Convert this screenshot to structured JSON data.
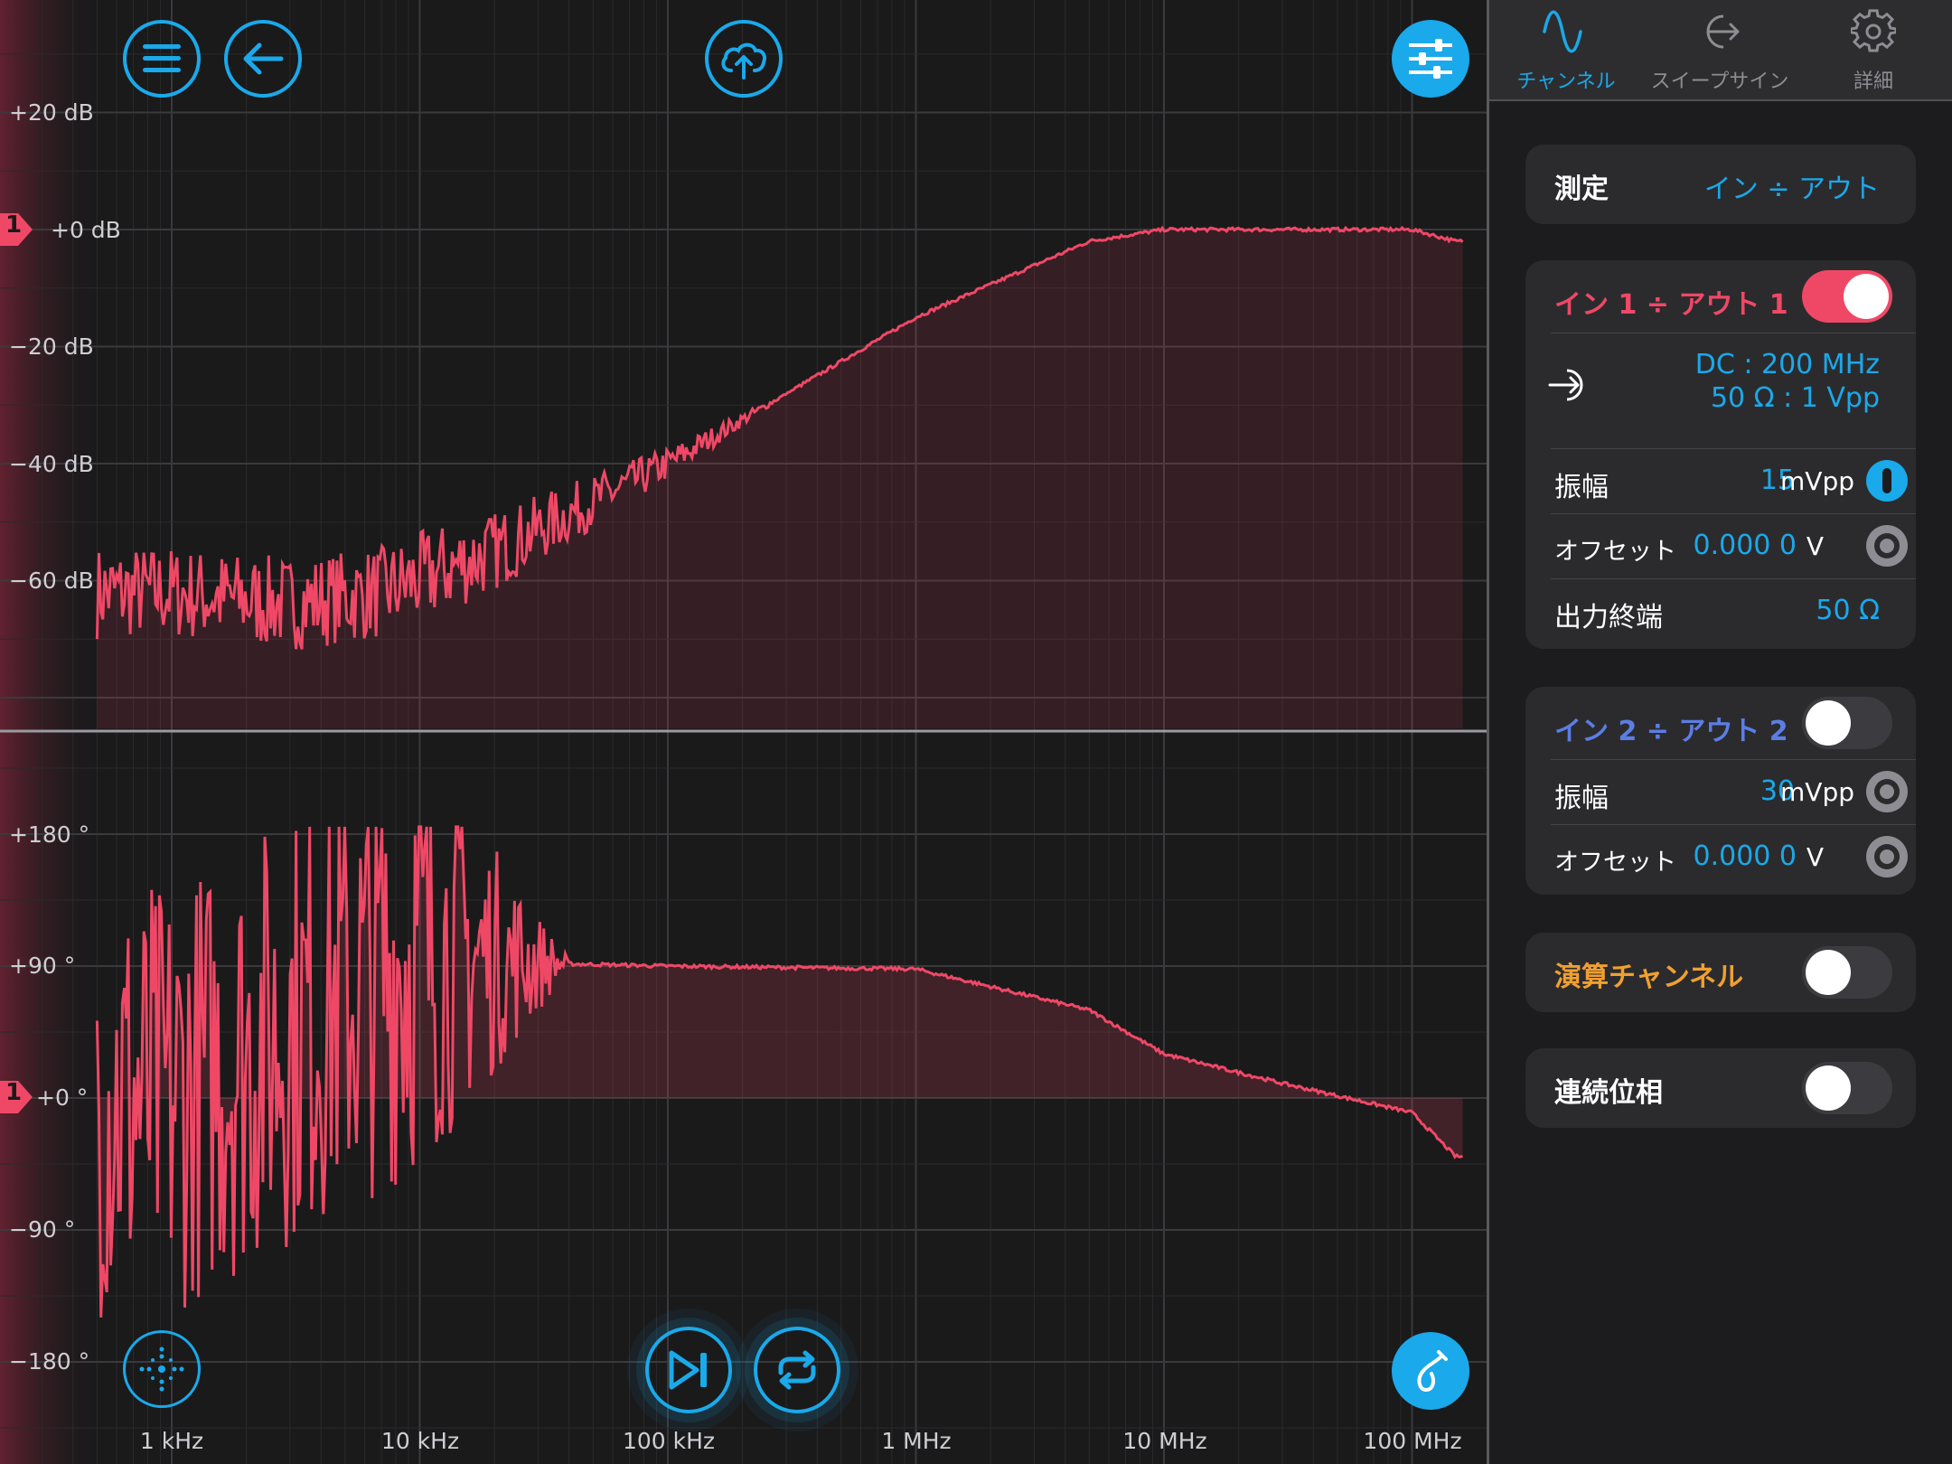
{
  "toolbar": {
    "menu_icon": "hamburger-menu-icon",
    "back_icon": "arrow-left-icon",
    "upload_icon": "cloud-upload-icon",
    "settings_icon": "sliders-icon"
  },
  "magnitude_axis": {
    "ticks": [
      "+20 dB",
      "+0 dB",
      "−20 dB",
      "−40 dB",
      "−60 dB"
    ],
    "marker": "1"
  },
  "phase_axis": {
    "ticks": [
      "+180 °",
      "+90 °",
      "+0 °",
      "−90 °",
      "−180 °"
    ],
    "marker": "1"
  },
  "freq_axis": {
    "ticks": [
      "1 kHz",
      "10 kHz",
      "100 kHz",
      "1 MHz",
      "10 MHz",
      "100 MHz"
    ]
  },
  "bottom_controls": {
    "crosshair_icon": "crosshair-icon",
    "step_icon": "skip-forward-icon",
    "repeat_icon": "repeat-icon",
    "probe_icon": "probe-hook-icon"
  },
  "chart_data": {
    "type": "line",
    "x_scale": "log",
    "xlim": [
      "500 Hz",
      "150 MHz"
    ],
    "magnitude": {
      "ylabel_unit": "dB",
      "ylim": [
        -80,
        30
      ],
      "points_hz_db": [
        [
          1000,
          -62
        ],
        [
          3000,
          -64
        ],
        [
          7000,
          -62
        ],
        [
          20000,
          -55
        ],
        [
          100000,
          -40
        ],
        [
          1000000,
          -15
        ],
        [
          5000000,
          -2
        ],
        [
          10000000,
          0
        ],
        [
          50000000,
          0
        ],
        [
          100000000,
          0
        ],
        [
          150000000,
          -2
        ]
      ]
    },
    "phase": {
      "ylabel_unit": "deg",
      "ylim": [
        -200,
        200
      ],
      "points_hz_deg": [
        [
          1000,
          0
        ],
        [
          10000,
          100
        ],
        [
          30000,
          92
        ],
        [
          100000,
          90
        ],
        [
          1000000,
          88
        ],
        [
          5000000,
          60
        ],
        [
          10000000,
          30
        ],
        [
          30000000,
          10
        ],
        [
          100000000,
          -10
        ],
        [
          150000000,
          -40
        ]
      ]
    },
    "grid": true,
    "series_color": "#ef4866"
  },
  "side_panel": {
    "tabs": [
      {
        "label": "チャンネル",
        "icon": "sine-wave-icon",
        "active": true
      },
      {
        "label": "スイープサイン",
        "icon": "sweep-out-icon",
        "active": false
      },
      {
        "label": "詳細",
        "icon": "gear-icon",
        "active": false
      }
    ],
    "measurement": {
      "label": "測定",
      "value": "イン ÷ アウト"
    },
    "ch1": {
      "title": "イン 1 ÷ アウト 1",
      "enabled": true,
      "input_line1": "DC : 200 MHz",
      "input_line2": "50 Ω : 1 Vpp",
      "amp_label": "振幅",
      "amp_value": "15",
      "amp_unit": "mVpp",
      "offset_label": "オフセット",
      "offset_value": "0.000 0",
      "offset_unit": "V",
      "term_label": "出力終端",
      "term_value": "50 Ω"
    },
    "ch2": {
      "title": "イン 2 ÷ アウト 2",
      "enabled": false,
      "amp_label": "振幅",
      "amp_value": "30",
      "amp_unit": "mVpp",
      "offset_label": "オフセット",
      "offset_value": "0.000 0",
      "offset_unit": "V"
    },
    "math_channel": {
      "label": "演算チャンネル",
      "enabled": false
    },
    "continuous_phase": {
      "label": "連続位相",
      "enabled": false
    },
    "colors": {
      "accent": "#1aa9ea",
      "ch1": "#ef4866",
      "ch2": "#5b7ee5",
      "math": "#f0a030"
    }
  }
}
